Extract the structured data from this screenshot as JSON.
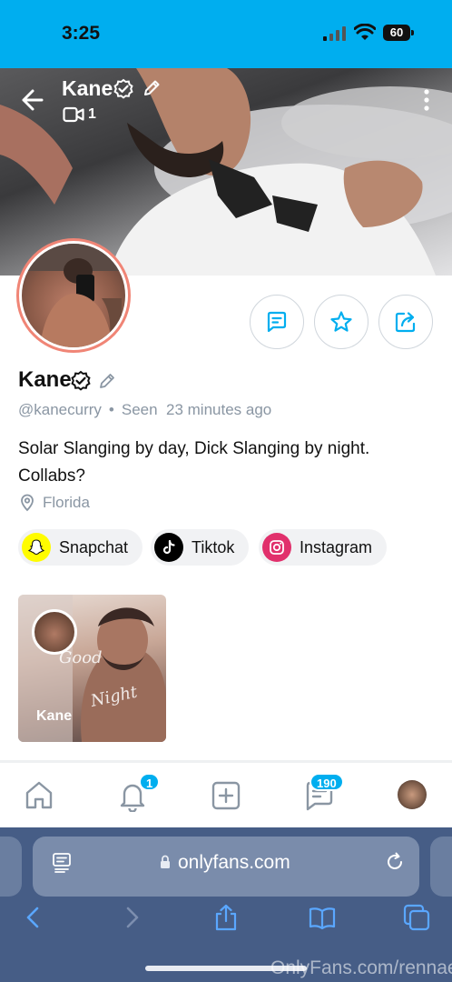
{
  "status_bar": {
    "time": "3:25",
    "battery": "60"
  },
  "header": {
    "name": "Kane",
    "video_count": "1"
  },
  "profile": {
    "name": "Kane",
    "handle": "@kanecurry",
    "seen_label": "Seen",
    "seen_time": "23 minutes ago",
    "bio": "Solar Slanging by day, Dick Slanging by night. Collabs?",
    "location": "Florida"
  },
  "actions": [
    {
      "name": "message-button",
      "icon": "message-icon"
    },
    {
      "name": "favorite-button",
      "icon": "star-icon"
    },
    {
      "name": "share-button",
      "icon": "share-icon"
    }
  ],
  "socials": [
    {
      "label": "Snapchat",
      "icon": "snapchat-icon",
      "color": "#FFFC00"
    },
    {
      "label": "Tiktok",
      "icon": "tiktok-icon",
      "color": "#000000"
    },
    {
      "label": "Instagram",
      "icon": "instagram-icon",
      "color": "#E1306C"
    }
  ],
  "story": {
    "name": "Kane",
    "overlay_text_1": "Good",
    "overlay_text_2": "Night"
  },
  "bottom_nav": {
    "notifications_badge": "1",
    "messages_badge": "190"
  },
  "browser": {
    "url": "onlyfans.com"
  },
  "watermark": "OnlyFans.com/rennae",
  "colors": {
    "accent": "#00AEEF",
    "text": "#111111",
    "muted": "#8A96A3",
    "safari_bar": "#465D86"
  }
}
